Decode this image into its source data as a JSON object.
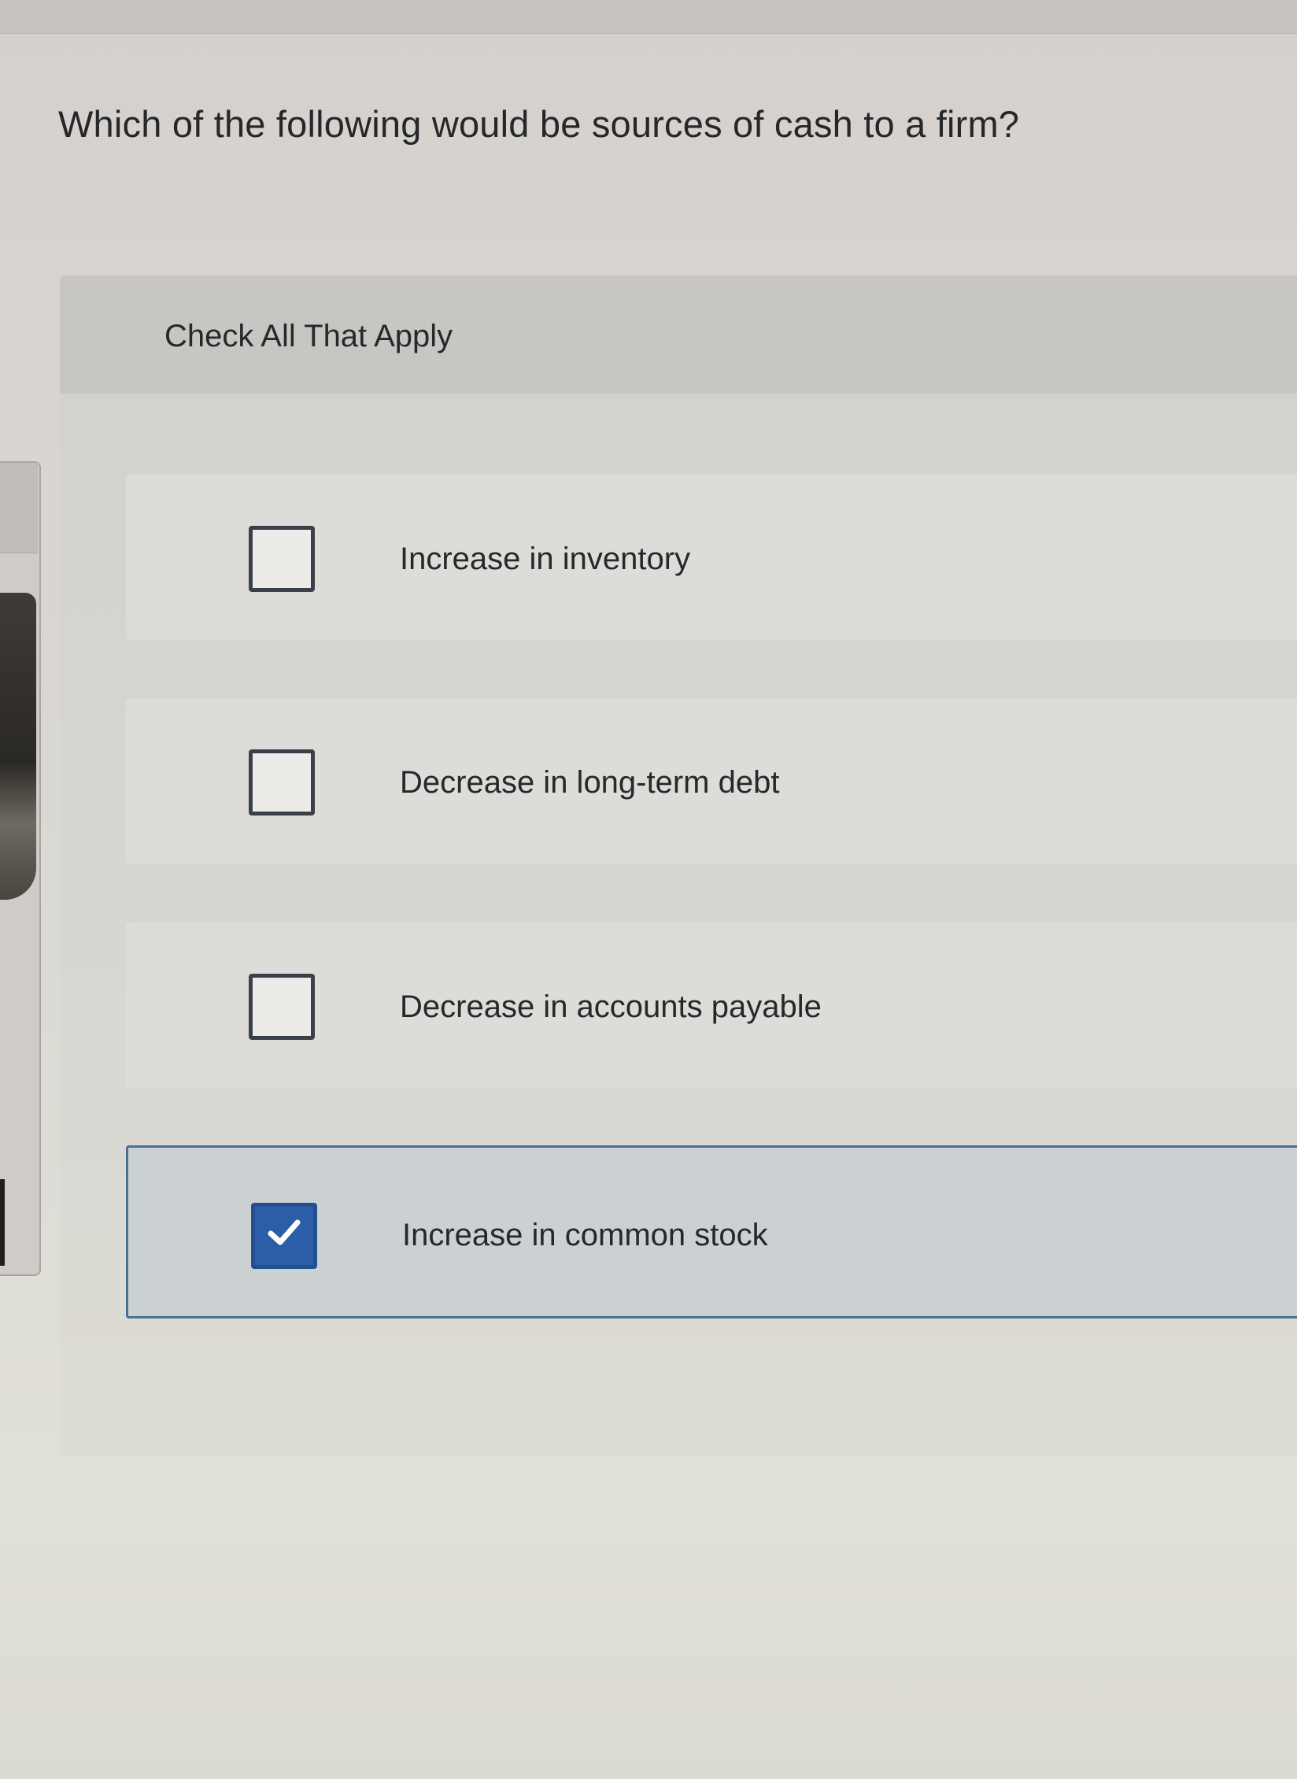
{
  "question": {
    "text": "Which of the following would be sources of cash to a firm?"
  },
  "panel": {
    "instruction": "Check All That Apply",
    "options": [
      {
        "label": "Increase in inventory",
        "checked": false
      },
      {
        "label": "Decrease in long-term debt",
        "checked": false
      },
      {
        "label": "Decrease in accounts payable",
        "checked": false
      },
      {
        "label": "Increase in common stock",
        "checked": true
      }
    ]
  },
  "colors": {
    "checked_fill": "#2c5ea8",
    "selected_border": "#4a6f93",
    "checkbox_border": "#3a4049"
  },
  "icons": {
    "checked": "checkmark-icon"
  }
}
